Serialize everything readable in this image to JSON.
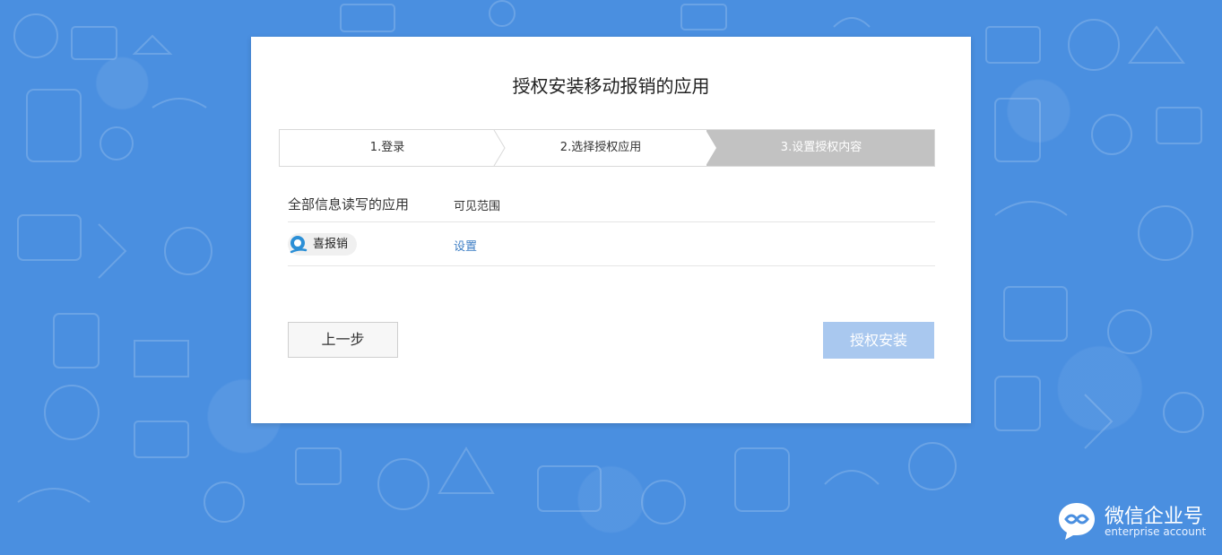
{
  "dialog": {
    "title": "授权安装移动报销的应用"
  },
  "steps": [
    {
      "label": "1.登录"
    },
    {
      "label": "2.选择授权应用"
    },
    {
      "label": "3.设置授权内容"
    }
  ],
  "table": {
    "header": {
      "app": "全部信息读写的应用",
      "scope": "可见范围"
    },
    "rows": [
      {
        "app_name": "喜报销",
        "action": "设置"
      }
    ]
  },
  "buttons": {
    "prev": "上一步",
    "install": "授权安装"
  },
  "brand": {
    "name": "微信企业号",
    "subtitle": "enterprise account"
  },
  "colors": {
    "background": "#4a8fe0",
    "active_step": "#c2c2c2",
    "link": "#3c7dc4",
    "primary_disabled": "#a9c8ef"
  }
}
